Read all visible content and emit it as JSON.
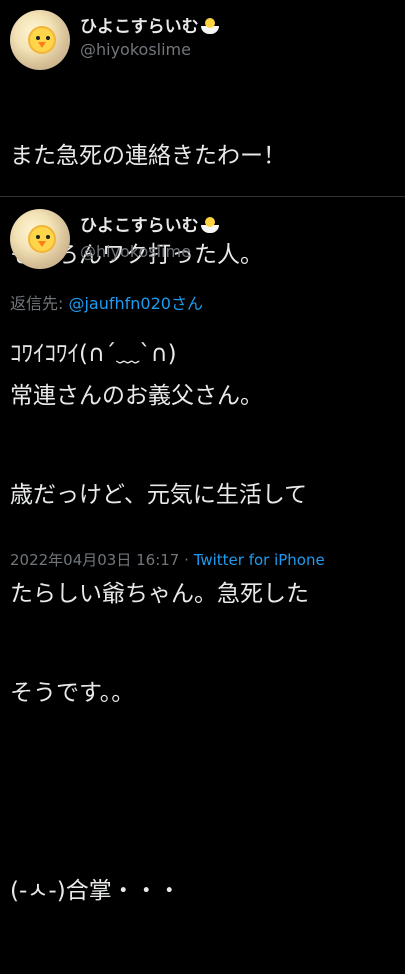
{
  "tweet1": {
    "display_name": "ひよこすらいむ",
    "handle": "@hiyokoslime",
    "text_lines": [
      "また急死の連絡きたわー！",
      "もちろんワク打った人。",
      "ｺﾜｲｺﾜｲ(∩´﹏`∩)"
    ]
  },
  "tweet2": {
    "display_name": "ひよこすらいむ",
    "handle": "@hiyokoslime",
    "reply_prefix": "返信先: ",
    "reply_mention": "@jaufhfn020さん",
    "text_lines": [
      "常連さんのお義父さん。",
      "歳だっけど、元気に生活して",
      "たらしい爺ちゃん。急死した",
      "そうです。。",
      "",
      "(-ㅅ-)合掌・・・"
    ],
    "timestamp": "2022年04月03日 16:17",
    "separator": " · ",
    "source": "Twitter for iPhone"
  },
  "icons": {
    "name_emoji": "hatching-chick-icon",
    "avatar": "chick-avatar"
  },
  "colors": {
    "background": "#000000",
    "text": "#e7e9ea",
    "muted": "#71767b",
    "link": "#1d9bf0",
    "divider": "#2f3336"
  }
}
